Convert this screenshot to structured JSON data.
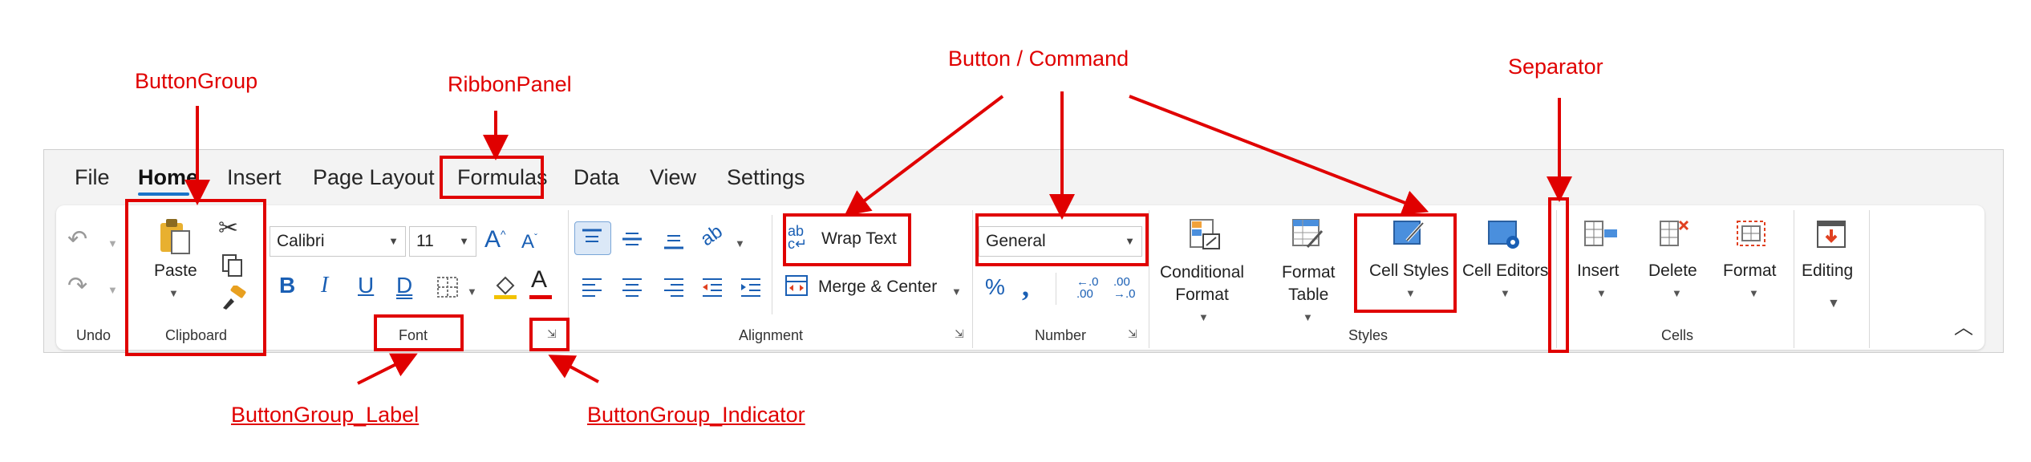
{
  "tabs": [
    "File",
    "Home",
    "Insert",
    "Page Layout",
    "Formulas",
    "Data",
    "View",
    "Settings"
  ],
  "groups": {
    "undo": {
      "label": "Undo"
    },
    "clipboard": {
      "label": "Clipboard",
      "paste_label": "Paste"
    },
    "font": {
      "label": "Font",
      "font_name": "Calibri",
      "font_size": "11"
    },
    "alignment": {
      "label": "Alignment",
      "wrap_text_label": "Wrap Text",
      "merge_center_label": "Merge & Center"
    },
    "number": {
      "label": "Number",
      "format_value": "General"
    },
    "styles": {
      "label": "Styles",
      "conditional_line1": "Conditional",
      "conditional_line2": "Format",
      "format_table_line1": "Format",
      "format_table_line2": "Table",
      "cell_styles_label": "Cell Styles",
      "cell_editors_label": "Cell Editors"
    },
    "cells": {
      "label": "Cells",
      "insert_label": "Insert",
      "delete_label": "Delete",
      "format_label": "Format"
    },
    "editing": {
      "label": "Editing"
    }
  },
  "annotations": {
    "button_group": "ButtonGroup",
    "ribbon_panel": "RibbonPanel",
    "button_command": "Button / Command",
    "separator": "Separator",
    "button_group_label": "ButtonGroup_Label",
    "button_group_indicator": "ButtonGroup_Indicator"
  },
  "colors": {
    "annotation": "#e00000",
    "accent": "#1a73c8"
  }
}
